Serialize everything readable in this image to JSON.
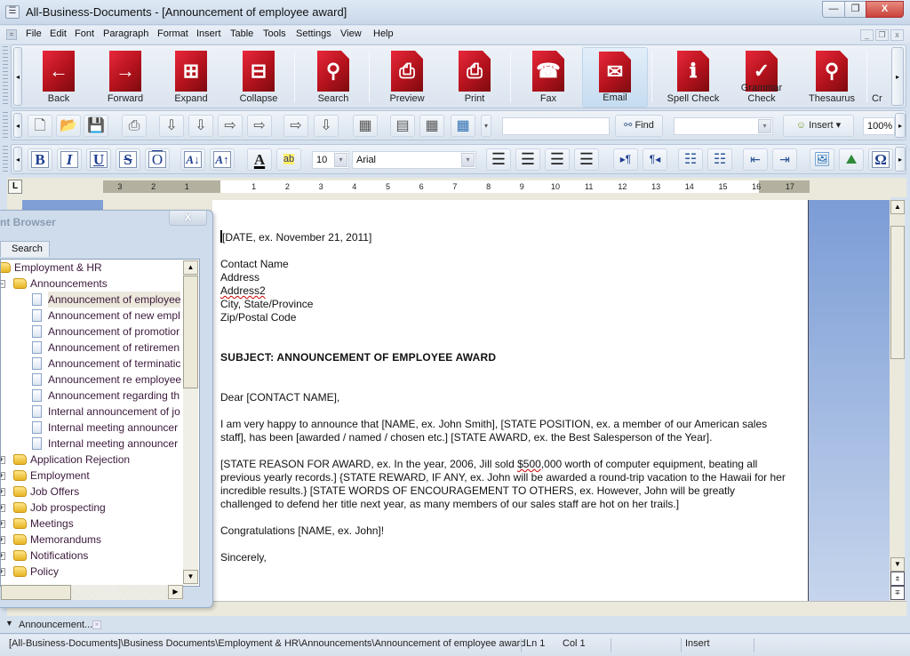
{
  "window": {
    "title": "All-Business-Documents - [Announcement of employee award]",
    "minimize": "—",
    "maximize": "❐",
    "close": "X"
  },
  "menubar": {
    "items": [
      "File",
      "Edit",
      "Font",
      "Paragraph",
      "Format",
      "Insert",
      "Table",
      "Tools",
      "Settings",
      "View",
      "Help"
    ]
  },
  "big_toolbar": {
    "buttons": [
      {
        "label": "Back",
        "icon": "back-arrow-icon",
        "glyph": "←"
      },
      {
        "label": "Forward",
        "icon": "forward-arrow-icon",
        "glyph": "→"
      },
      {
        "label": "Expand",
        "icon": "expand-tree-icon",
        "glyph": "⊞"
      },
      {
        "label": "Collapse",
        "icon": "collapse-tree-icon",
        "glyph": "⊟"
      },
      {
        "label": "Search",
        "icon": "search-icon",
        "glyph": "⚲"
      },
      {
        "label": "Preview",
        "icon": "print-preview-icon",
        "glyph": "⎙"
      },
      {
        "label": "Print",
        "icon": "printer-icon",
        "glyph": "⎙"
      },
      {
        "label": "Fax",
        "icon": "fax-icon",
        "glyph": "☎"
      },
      {
        "label": "Email",
        "icon": "envelope-icon",
        "glyph": "✉"
      },
      {
        "label": "Spell Check",
        "icon": "spell-check-icon",
        "glyph": "ℹ"
      },
      {
        "label": "Grammar Check",
        "icon": "grammar-check-icon",
        "glyph": "✓"
      },
      {
        "label": "Thesaurus",
        "icon": "thesaurus-icon",
        "glyph": "⚲"
      },
      {
        "label": "Cr",
        "icon": "truncated-icon",
        "glyph": ""
      }
    ],
    "active": "Email"
  },
  "std_toolbar": {
    "find_label": "Find",
    "find_value": "",
    "combo_value": "",
    "insert_label": "Insert",
    "zoom": "100%"
  },
  "format_toolbar": {
    "bold": "B",
    "italic": "I",
    "underline": "U",
    "strike": "S",
    "overline": "O",
    "font_size": "10",
    "font_name": "Arial",
    "omega": "Ω"
  },
  "ruler": {
    "left_numbers": [
      "3",
      "2",
      "1"
    ],
    "right_numbers": [
      "1",
      "2",
      "3",
      "4",
      "5",
      "6",
      "7",
      "8",
      "9",
      "10",
      "11",
      "12",
      "13",
      "14",
      "15",
      "16",
      "17"
    ]
  },
  "panel": {
    "title": "nt Browser",
    "tab": "Search",
    "close": "X",
    "tree": [
      {
        "label": "Employment & HR",
        "type": "folder",
        "level": 0
      },
      {
        "label": "Announcements",
        "type": "folder",
        "level": 1,
        "expanded": true
      },
      {
        "label": "Announcement of employee",
        "type": "doc",
        "level": 2,
        "selected": true
      },
      {
        "label": "Announcement of new empl",
        "type": "doc",
        "level": 2
      },
      {
        "label": "Announcement of promotior",
        "type": "doc",
        "level": 2
      },
      {
        "label": "Announcement of retiremen",
        "type": "doc",
        "level": 2
      },
      {
        "label": "Announcement of terminatic",
        "type": "doc",
        "level": 2
      },
      {
        "label": "Announcement re employee",
        "type": "doc",
        "level": 2
      },
      {
        "label": "Announcement regarding th",
        "type": "doc",
        "level": 2
      },
      {
        "label": "Internal announcement of jo",
        "type": "doc",
        "level": 2
      },
      {
        "label": "Internal meeting announcer",
        "type": "doc",
        "level": 2
      },
      {
        "label": "Internal meeting announcer",
        "type": "doc",
        "level": 2
      },
      {
        "label": "Application Rejection",
        "type": "folder",
        "level": 1
      },
      {
        "label": "Employment",
        "type": "folder",
        "level": 1
      },
      {
        "label": "Job Offers",
        "type": "folder",
        "level": 1
      },
      {
        "label": "Job prospecting",
        "type": "folder",
        "level": 1
      },
      {
        "label": "Meetings",
        "type": "folder",
        "level": 1
      },
      {
        "label": "Memorandums",
        "type": "folder",
        "level": 1
      },
      {
        "label": "Notifications",
        "type": "folder",
        "level": 1
      },
      {
        "label": "Policy",
        "type": "folder",
        "level": 1
      }
    ]
  },
  "document": {
    "date": "[DATE, ex. November 21, 2011]",
    "address": [
      "Contact Name",
      "Address",
      "Address2",
      "City, State/Province",
      "Zip/Postal Code"
    ],
    "subject": "SUBJECT: ANNOUNCEMENT OF EMPLOYEE AWARD",
    "salutation": "Dear [CONTACT NAME],",
    "para1": "I am very happy to announce that [NAME, ex. John Smith], [STATE POSITION, ex. a member of our American sales staff], has been [awarded / named / chosen etc.] [STATE AWARD, ex. the Best Salesperson of the Year].",
    "para2_a": "[STATE REASON FOR AWARD, ex. In the year, 2006, Jill sold ",
    "para2_b": "$500",
    "para2_c": ",000 worth of computer equipment, beating all previous yearly records.]  {STATE REWARD, IF ANY, ex. John will be awarded a round-trip vacation to the Hawaii for her incredible results.}  [STATE WORDS OF ENCOURAGEMENT TO OTHERS, ex. However, John will be greatly challenged to defend her title next year, as many members of our sales staff are hot on her trails.]",
    "congrats": "Congratulations [NAME, ex. John]!",
    "closing": "Sincerely,"
  },
  "doc_tabs": {
    "active_tab": "Announcement..."
  },
  "status": {
    "path": "[All-Business-Documents]\\Business Documents\\Employment & HR\\Announcements\\Announcement of employee award",
    "line": "Ln 1",
    "col": "Col 1",
    "mode": "Insert"
  }
}
